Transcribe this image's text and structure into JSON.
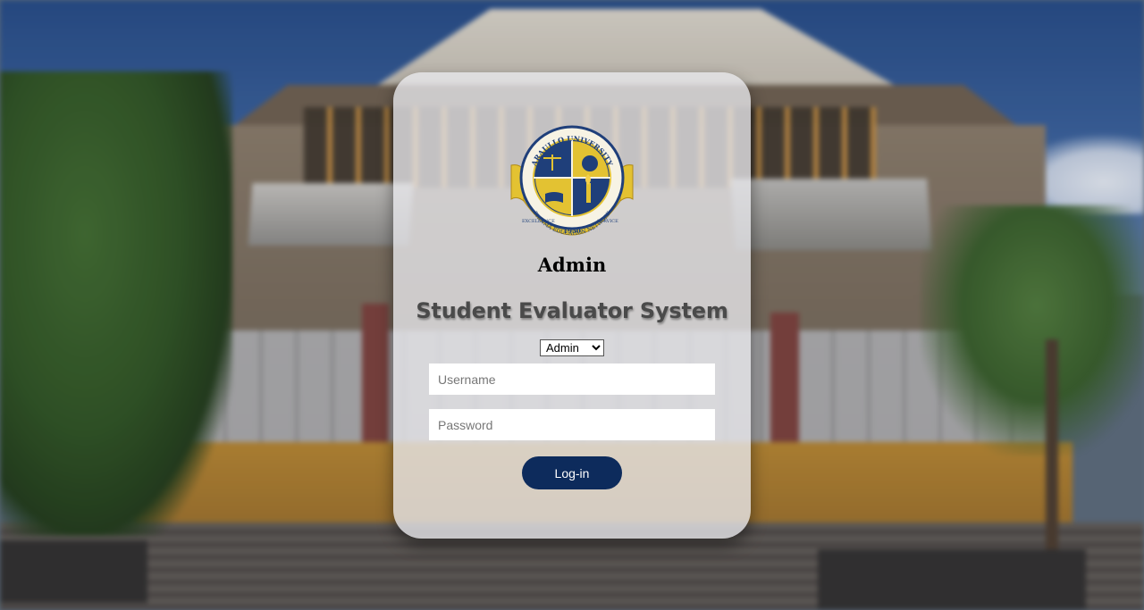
{
  "seal": {
    "top_text": "ARAULLO UNIVERSITY",
    "ring_text": "PHINMA EDUCATION NETWORK",
    "left_motto": "EXCELLENCE",
    "right_motto": "SERVICE",
    "year": "1950"
  },
  "login": {
    "role_title": "Admin",
    "system_title": "Student Evaluator System",
    "role_select": {
      "selected": "Admin"
    },
    "username_placeholder": "Username",
    "password_placeholder": "Password",
    "login_label": "Log-in"
  },
  "colors": {
    "primary_button": "#0d2b5c",
    "seal_blue": "#1f3f7a",
    "seal_gold": "#e3c232"
  }
}
